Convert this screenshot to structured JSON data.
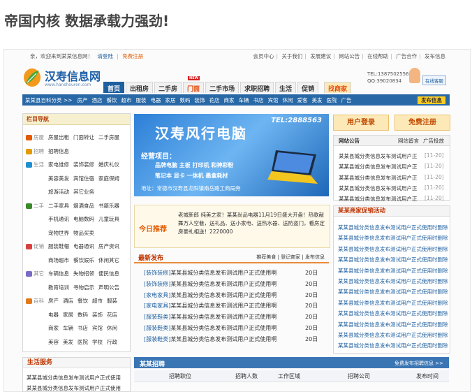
{
  "page_heading": "帝国内核 数据承载力强劲!",
  "topbar": {
    "welcome": "亲，欢迎来到某某信息网！",
    "login": "请登陆",
    "register": "免费注册",
    "links": [
      "会员中心",
      "关于我们",
      "发展建议",
      "网站公告",
      "在线帮助",
      "广告合作",
      "发布信息"
    ]
  },
  "logo": {
    "name": "汉寿信息网",
    "domain": "www.hanshouren.com"
  },
  "nav": {
    "tabs": [
      "首页",
      "出租房",
      "二手房",
      "门面",
      "二手市场",
      "求职招聘",
      "生活",
      "促销",
      "找商家"
    ],
    "badge": "NEW"
  },
  "contact": {
    "tel": "TEL:13875025566",
    "qq": "QQ:39020834",
    "service": "在线客服"
  },
  "subnav": {
    "label": "某某县百科分类 >>",
    "items": [
      "房产",
      "酒店",
      "餐饮",
      "超市",
      "服装",
      "电器",
      "家居",
      "数码",
      "装饰",
      "花店",
      "商家",
      "车辆",
      "书店",
      "宾馆",
      "休闲",
      "爱客",
      "美发",
      "医院",
      "广告"
    ],
    "publish": "发布信息"
  },
  "categories": {
    "title": "栏目导航",
    "rows": [
      {
        "name": "房屋",
        "links": [
          "房屋出租",
          "门面转让",
          "二手房屋"
        ]
      },
      {
        "name": "招聘",
        "links": [
          "招聘信息"
        ]
      },
      {
        "name": "生活",
        "links": [
          "家电维修",
          "装饰装修",
          "婚庆礼仪"
        ]
      },
      {
        "name": "",
        "links": [
          "美容美发",
          "宾馆住宿",
          "家庭保姆"
        ]
      },
      {
        "name": "",
        "links": [
          "旅游活动",
          "其它业务"
        ]
      },
      {
        "name": "二手",
        "links": [
          "二手家具",
          "烟酒食品",
          "书籍乐器"
        ]
      },
      {
        "name": "",
        "links": [
          "手机通讯",
          "电脑数码",
          "儿童玩具"
        ]
      },
      {
        "name": "",
        "links": [
          "宠物世界",
          "物品买卖"
        ]
      },
      {
        "name": "促销",
        "links": [
          "服装鞋帽",
          "电器通讯",
          "房产资讯"
        ]
      },
      {
        "name": "",
        "links": [
          "商场超市",
          "餐饮娱乐",
          "休闲其它"
        ]
      },
      {
        "name": "其它",
        "links": [
          "车辆信息",
          "失物招领",
          "便民信息"
        ]
      },
      {
        "name": "",
        "links": [
          "教育培训",
          "寻物启示",
          "声明公告"
        ]
      },
      {
        "name": "百科",
        "links": [
          "房产",
          "酒店",
          "餐饮",
          "超市",
          "服装"
        ]
      },
      {
        "name": "",
        "links": [
          "电器",
          "家居",
          "数码",
          "装饰",
          "花店"
        ]
      },
      {
        "name": "",
        "links": [
          "商家",
          "车辆",
          "书店",
          "宾馆",
          "休闲"
        ]
      },
      {
        "name": "",
        "links": [
          "美容",
          "美发",
          "医院",
          "学校",
          "行政"
        ]
      }
    ]
  },
  "banner": {
    "title": "汉寿风行电脑",
    "tel": "TEL:2888563",
    "business": "经营项目：",
    "products": [
      "品牌电脑  主板  打印机  和神彩粉",
      "笔记本  显卡  一体机  墨盒耗材"
    ],
    "address": "地址：常德市汉寿县龙阳镇南岳路工商局旁"
  },
  "recommend": {
    "label": "今日推荐",
    "text": "老城新郎 纯美之家！某某尚品电器11月19日盛大开盘！热歌献舞万人空巷，送礼品、送小家电、送热水器、送防盗门，看房定房豪礼相送！2220000"
  },
  "latest": {
    "title": "最新发布",
    "links": [
      "推荐美食",
      "登记商家",
      "发布信息"
    ],
    "rows": [
      {
        "tag": "[装饰装修]",
        "text": "某某县城分类信息发布测试用户正式使用啊",
        "date": "20日"
      },
      {
        "tag": "[装饰装修]",
        "text": "某某县城分类信息发布测试用户正式使用啊",
        "date": "20日"
      },
      {
        "tag": "[家电家具]",
        "text": "某某县城分类信息发布测试用户正式使用啊",
        "date": "20日"
      },
      {
        "tag": "[家电家具]",
        "text": "某某县城分类信息发布测试用户正式使用啊",
        "date": "20日"
      },
      {
        "tag": "[服装鞋类]",
        "text": "某某县城分类信息发布测试用户正式使用啊",
        "date": "20日"
      },
      {
        "tag": "[服装鞋类]",
        "text": "某某县城分类信息发布测试用户正式使用啊",
        "date": "20日"
      },
      {
        "tag": "[服装鞋类]",
        "text": "某某县城分类信息发布测试用户正式使用啊",
        "date": "20日"
      }
    ]
  },
  "user": {
    "login": "用户登录",
    "register": "免费注册"
  },
  "notice": {
    "tabs": [
      "网站公告",
      "网站留言",
      "广告投放"
    ],
    "rows": [
      {
        "text": "某某县城分类信息发布测试用户正",
        "date": "[11-20]"
      },
      {
        "text": "某某县城分类信息发布测试用户正",
        "date": "[11-20]"
      },
      {
        "text": "某某县城分类信息发布测试用户正",
        "date": "[11-20]"
      },
      {
        "text": "某某县城分类信息发布测试用户正",
        "date": "[11-20]"
      },
      {
        "text": "某某县城分类信息发布测试用户正",
        "date": "[11-20]"
      }
    ]
  },
  "promo": {
    "title": "某某商家促销活动",
    "rows": [
      "某某县城分类信息发布测试用户正式使用时删除",
      "某某县城分类信息发布测试用户正式使用时删除",
      "某某县城分类信息发布测试用户正式使用时删除",
      "某某县城分类信息发布测试用户正式使用时删除",
      "某某县城分类信息发布测试用户正式使用时删除",
      "某某县城分类信息发布测试用户正式使用时删除",
      "某某县城分类信息发布测试用户正式使用时删除",
      "某某县城分类信息发布测试用户正式使用时删除",
      "某某县城分类信息发布测试用户正式使用时删除",
      "某某县城分类信息发布测试用户正式使用时删除",
      "某某县城分类信息发布测试用户正式使用时删除",
      "某某县城分类信息发布测试用户正式使用时删除"
    ]
  },
  "life": {
    "title": "生活服务",
    "rows": [
      "某某县城分类信息发布测试用户正式使用",
      "某某县城分类信息发布测试用户正式使用"
    ]
  },
  "jobs": {
    "title": "某某招聘",
    "free_post": "免费发布招聘信息 >>",
    "columns": [
      "招聘职位",
      "招聘人数",
      "工作区域",
      "招聘公司",
      "发布时间"
    ]
  },
  "colors": {
    "primary_blue": "#1f5f9f",
    "accent_orange": "#e35a00",
    "nav_blue": "#2868a6"
  }
}
